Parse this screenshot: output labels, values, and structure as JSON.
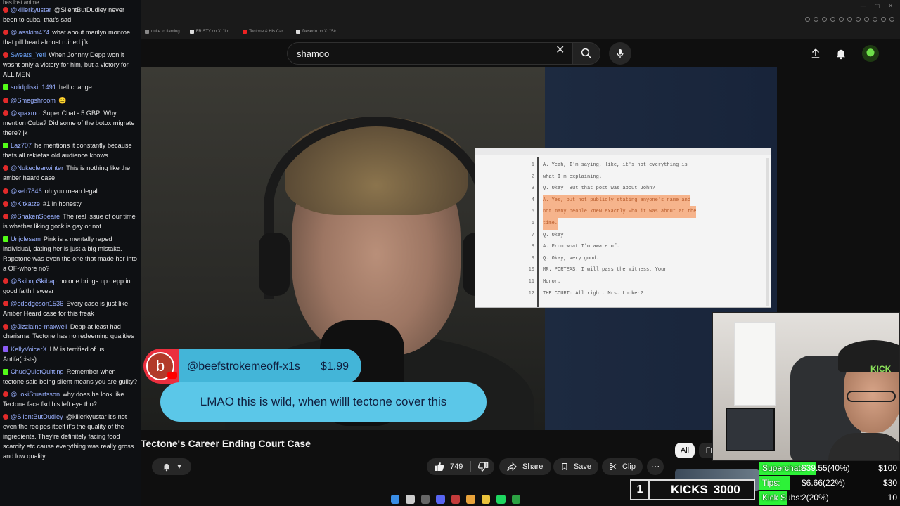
{
  "browser": {
    "tabs": [
      {
        "label": "quite to flaming",
        "color": "#888"
      },
      {
        "label": "FR!STY on X: \"I d...",
        "color": "#ddd"
      },
      {
        "label": "Tectone & His Car...",
        "color": "#e22"
      },
      {
        "label": "Deserto on X: \"Str...",
        "color": "#ddd"
      }
    ]
  },
  "header": {
    "search_value": "shamoo",
    "search_placeholder": "Search",
    "clear_icon": "close-icon",
    "search_icon": "search-icon",
    "mic_icon": "mic-icon",
    "create_icon": "upload-icon",
    "notifications_icon": "bell-icon"
  },
  "video": {
    "title": "Tectone's Career Ending Court Case",
    "document_lines": [
      {
        "num": "1",
        "text": "A.  Yeah, I'm saying, like, it's not everything is",
        "hl": false
      },
      {
        "num": "2",
        "text": "what I'm explaining.",
        "hl": false
      },
      {
        "num": "3",
        "text": "Q.  Okay.  But that post was about John?",
        "hl": false
      },
      {
        "num": "4",
        "text": "A.  Yes, but not publicly stating anyone's name and",
        "hl": true
      },
      {
        "num": "5",
        "text": "not many people knew exactly who it was about at the",
        "hl": true
      },
      {
        "num": "6",
        "text": "time.",
        "hl": true
      },
      {
        "num": "7",
        "text": "Q.  Okay.",
        "hl": false
      },
      {
        "num": "8",
        "text": "A.  From what I'm aware of.",
        "hl": false
      },
      {
        "num": "9",
        "text": "Q.  Okay, very good.",
        "hl": false
      },
      {
        "num": "10",
        "text": "        MR. PORTEAS:  I will pass the witness, Your",
        "hl": false
      },
      {
        "num": "11",
        "text": "Honor.",
        "hl": false
      },
      {
        "num": "12",
        "text": "        THE COURT:  All right.  Mrs. Locker?",
        "hl": false
      }
    ]
  },
  "superchat": {
    "avatar_letter": "b",
    "name": "@beefstrokemeoff-x1s",
    "amount": "$1.99",
    "message": "LMAO this is wild, when willl tectone cover this"
  },
  "actions": {
    "like_count": "749",
    "share_label": "Share",
    "save_label": "Save",
    "clip_label": "Clip",
    "more_label": "⋯",
    "bell_label": "▾"
  },
  "chips": {
    "all_label": "All",
    "from_label": "Fr"
  },
  "chat": {
    "top_text": "has lost anime",
    "messages": [
      {
        "platform": "yt",
        "user": "@killerkyustar",
        "user_color": "#9ab0ff",
        "text": "@SilentButDudley never been to cuba! that's sad"
      },
      {
        "platform": "yt",
        "user": "@lasskim474",
        "user_color": "#9ab0ff",
        "text": "what about marilyn monroe that pill head almost ruined jfk"
      },
      {
        "platform": "yt",
        "user": "Sweats_Yeti",
        "user_color": "#6fa8ff",
        "text": "When Johnny Depp won it wasnt only a victory for him, but a victory for ALL MEN"
      },
      {
        "platform": "kick",
        "user": "solidpliskin1491",
        "user_color": "#9ab0ff",
        "text": "hell change"
      },
      {
        "platform": "yt",
        "user": "@Smegshroom",
        "user_color": "#9ab0ff",
        "text": "😐"
      },
      {
        "platform": "yt",
        "user": "@kpaxmo",
        "user_color": "#9ab0ff",
        "text": "Super Chat - 5 GBP: Why mention Cuba? Did some of the botox migrate there? jk"
      },
      {
        "platform": "kick",
        "user": "Laz707",
        "user_color": "#9ab0ff",
        "text": "he mentions it constantly because thats all rekietas old audience knows"
      },
      {
        "platform": "yt",
        "user": "@Nukeclearwinter",
        "user_color": "#9ab0ff",
        "text": "This is nothing like the amber heard case"
      },
      {
        "platform": "yt",
        "user": "@keb7846",
        "user_color": "#9ab0ff",
        "text": "oh you mean legal"
      },
      {
        "platform": "yt",
        "user": "@Kitkatze",
        "user_color": "#9ab0ff",
        "text": "#1 in honesty"
      },
      {
        "platform": "yt",
        "user": "@ShakenSpeare",
        "user_color": "#9ab0ff",
        "text": "The real issue of our time is whether liking gock is gay or not"
      },
      {
        "platform": "kick",
        "user": "Unjclesam",
        "user_color": "#9ab0ff",
        "text": "Pink is a mentally raped individual, dating her is just a big mistake. Rapetone was even the one that made her into a OF-whore no?"
      },
      {
        "platform": "yt",
        "user": "@SkibopSkibap",
        "user_color": "#9ab0ff",
        "text": "no one brings up depp in good faith I swear"
      },
      {
        "platform": "yt",
        "user": "@edodgeson1536",
        "user_color": "#9ab0ff",
        "text": "Every case is just like Amber Heard case for this freak"
      },
      {
        "platform": "yt",
        "user": "@Jizzlaine-maxwell",
        "user_color": "#9ab0ff",
        "text": "Depp at least had charisma. Tectone has no redeeming qualities"
      },
      {
        "platform": "twitch",
        "user": "KellyVoicerX",
        "user_color": "#9ab0ff",
        "text": "LM is terrified of us Antifa(cists)"
      },
      {
        "platform": "kick",
        "user": "ChudQuietQuitting",
        "user_color": "#9ab0ff",
        "text": "Remember when tectone said being silent means you are guilty?"
      },
      {
        "platform": "yt",
        "user": "@LokiStuartsson",
        "user_color": "#9ab0ff",
        "text": "why does he look like Tectone face fkd his left eye tho?"
      },
      {
        "platform": "yt",
        "user": "@SilentButDudley",
        "user_color": "#9ab0ff",
        "text": "@killerkyustar it's not even the recipes itself it's the quality of the ingredients. They're definitely facing food scarcity etc cause everything was really gross and low quality"
      }
    ]
  },
  "webcam": {
    "cap_text": "KICK"
  },
  "goals": {
    "kicks_count": "1",
    "kicks_label": "KICKS",
    "kicks_goal": "3000",
    "rows": [
      {
        "label": "Superchats:",
        "value": "$39.55(40%)",
        "target": "$100",
        "fraction": 0.4
      },
      {
        "label": "Tips:",
        "value": "$6.66(22%)",
        "target": "$30",
        "fraction": 0.22
      },
      {
        "label": "Kick Subs:",
        "value": "2(20%)",
        "target": "10",
        "fraction": 0.2
      }
    ]
  },
  "taskbar": {
    "icons": [
      {
        "name": "windows-start-icon",
        "color": "#3a8ee6"
      },
      {
        "name": "search-icon",
        "color": "#ccc"
      },
      {
        "name": "camera-icon",
        "color": "#666"
      },
      {
        "name": "discord-icon",
        "color": "#5865f2"
      },
      {
        "name": "obs-icon",
        "color": "#c43b3b"
      },
      {
        "name": "chrome-icon",
        "color": "#e9a33b"
      },
      {
        "name": "folder-icon",
        "color": "#e9c23b"
      },
      {
        "name": "spotify-icon",
        "color": "#1ed760"
      },
      {
        "name": "xbox-icon",
        "color": "#2ca243"
      }
    ]
  }
}
